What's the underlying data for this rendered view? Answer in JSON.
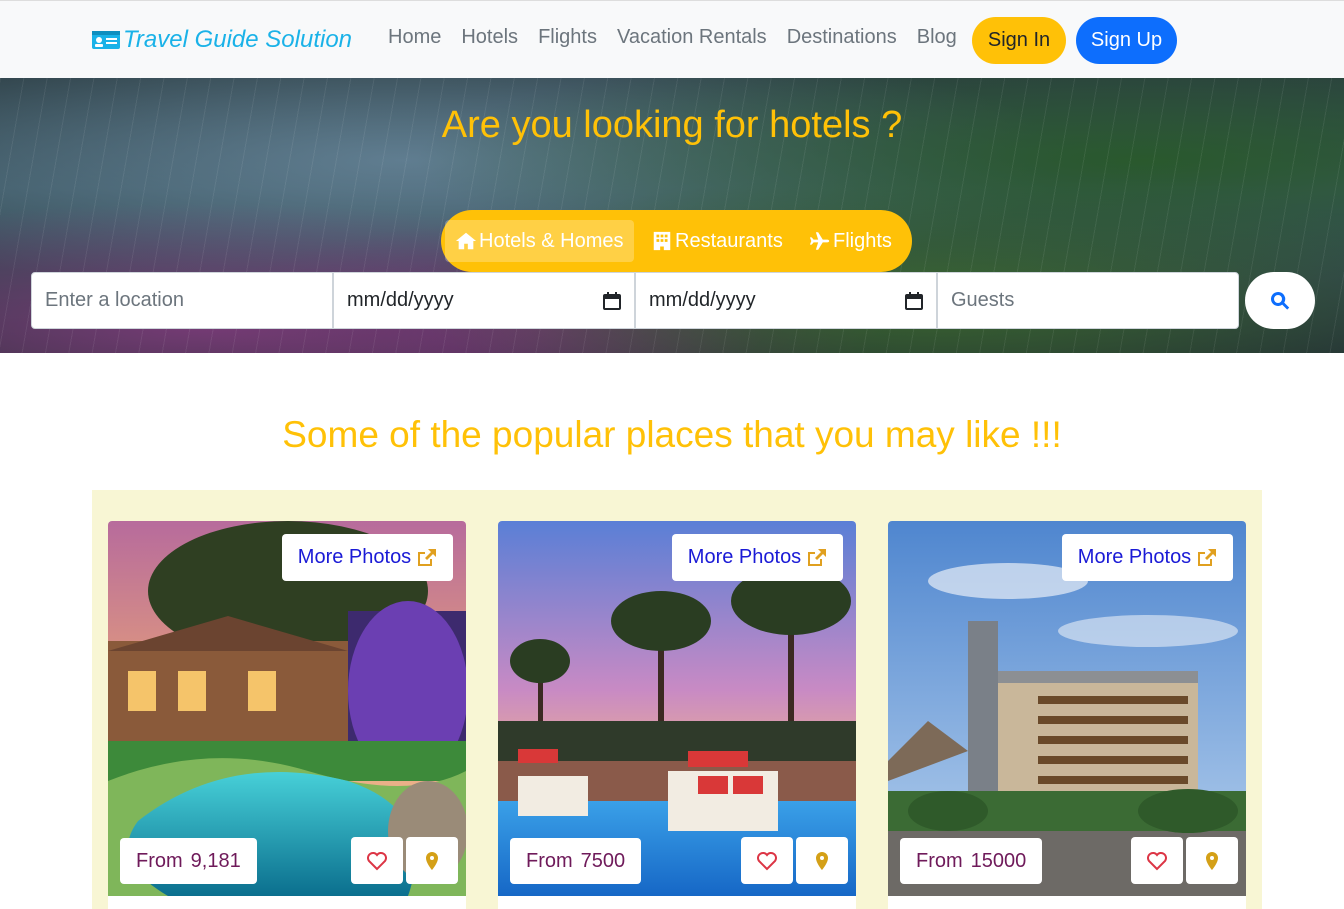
{
  "nav": {
    "brand": "Travel Guide Solution",
    "links": [
      "Home",
      "Hotels",
      "Flights",
      "Vacation Rentals",
      "Destinations",
      "Blog"
    ],
    "sign_in": "Sign In",
    "sign_up": "Sign Up"
  },
  "hero": {
    "title": "Are you looking for hotels ?",
    "tabs": [
      {
        "label": "Hotels & Homes",
        "icon": "home-icon",
        "active": true
      },
      {
        "label": "Restaurants",
        "icon": "building-icon",
        "active": false
      },
      {
        "label": "Flights",
        "icon": "plane-icon",
        "active": false
      }
    ],
    "location_placeholder": "Enter a location",
    "checkin_value": "mm/dd/yyyy",
    "checkout_value": "mm/dd/yyyy",
    "guests_placeholder": "Guests"
  },
  "popular": {
    "title": "Some of the popular places that you may like !!!",
    "cards": [
      {
        "more_photos": "More Photos",
        "from_label": "From",
        "price": "9,181"
      },
      {
        "more_photos": "More Photos",
        "from_label": "From",
        "price": "7500"
      },
      {
        "more_photos": "More Photos",
        "from_label": "From",
        "price": "15000"
      }
    ]
  },
  "colors": {
    "accent_yellow": "#ffc107",
    "primary_blue": "#0d6efd",
    "brand_cyan": "#1ab2e8",
    "price_purple": "#6f1a5a",
    "heart_red": "#dc3545",
    "pin_gold": "#d4a017"
  }
}
